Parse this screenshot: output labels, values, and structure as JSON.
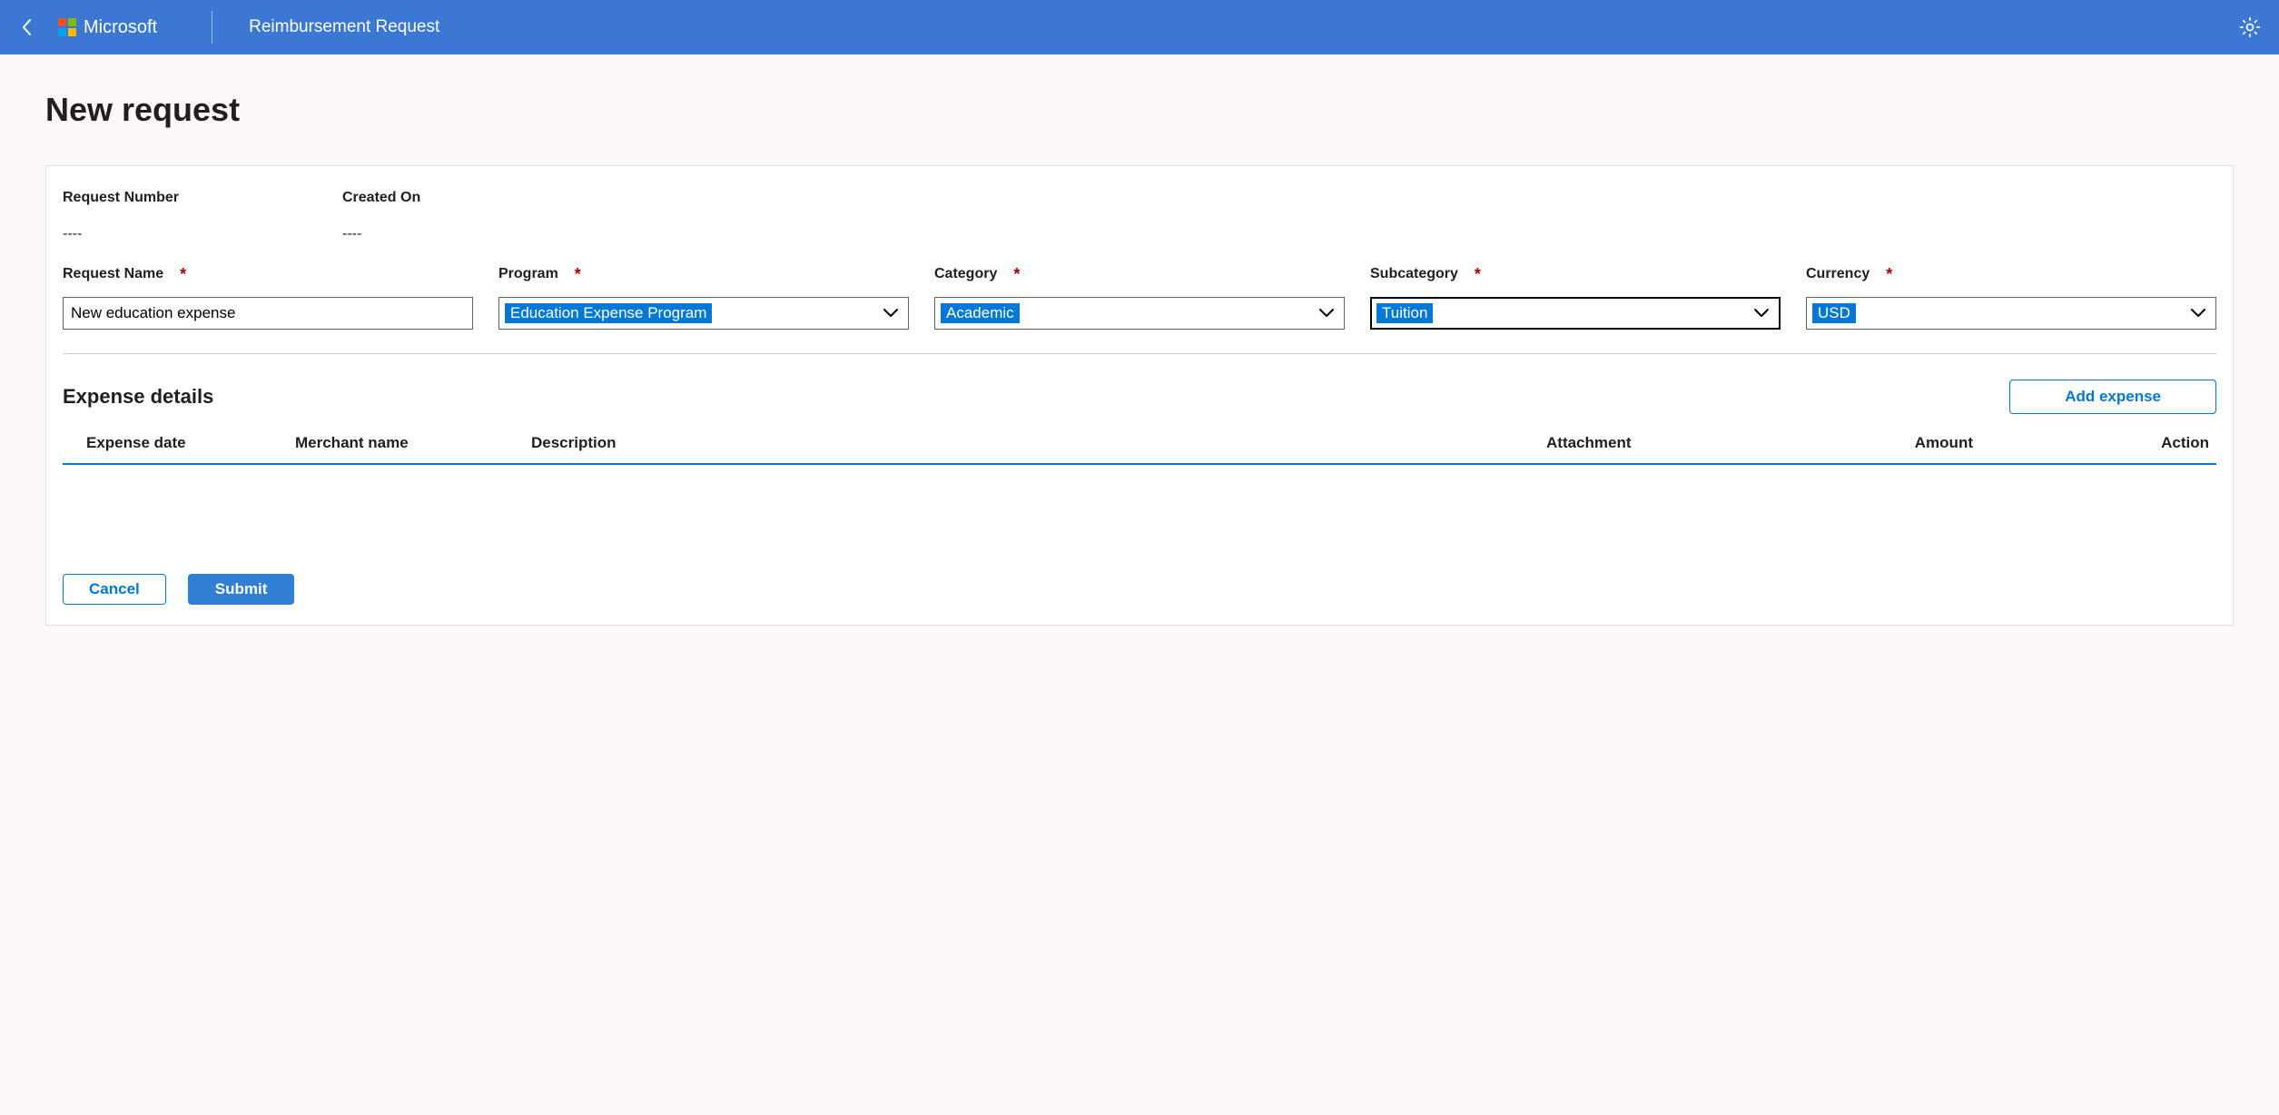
{
  "header": {
    "brand": "Microsoft",
    "app_title": "Reimbursement Request"
  },
  "page": {
    "title": "New request"
  },
  "meta": {
    "request_number_label": "Request Number",
    "request_number_value": "----",
    "created_on_label": "Created On",
    "created_on_value": "----"
  },
  "fields": {
    "request_name": {
      "label": "Request Name",
      "value": "New education expense"
    },
    "program": {
      "label": "Program",
      "value": "Education Expense Program"
    },
    "category": {
      "label": "Category",
      "value": "Academic"
    },
    "subcategory": {
      "label": "Subcategory",
      "value": "Tuition"
    },
    "currency": {
      "label": "Currency",
      "value": "USD"
    }
  },
  "details": {
    "title": "Expense details",
    "add_button": "Add expense",
    "columns": {
      "date": "Expense date",
      "merchant": "Merchant name",
      "description": "Description",
      "attachment": "Attachment",
      "amount": "Amount",
      "action": "Action"
    }
  },
  "footer": {
    "cancel": "Cancel",
    "submit": "Submit"
  },
  "colors": {
    "logo": {
      "tl": "#f25022",
      "tr": "#7fba00",
      "bl": "#00a4ef",
      "br": "#ffb900"
    }
  }
}
